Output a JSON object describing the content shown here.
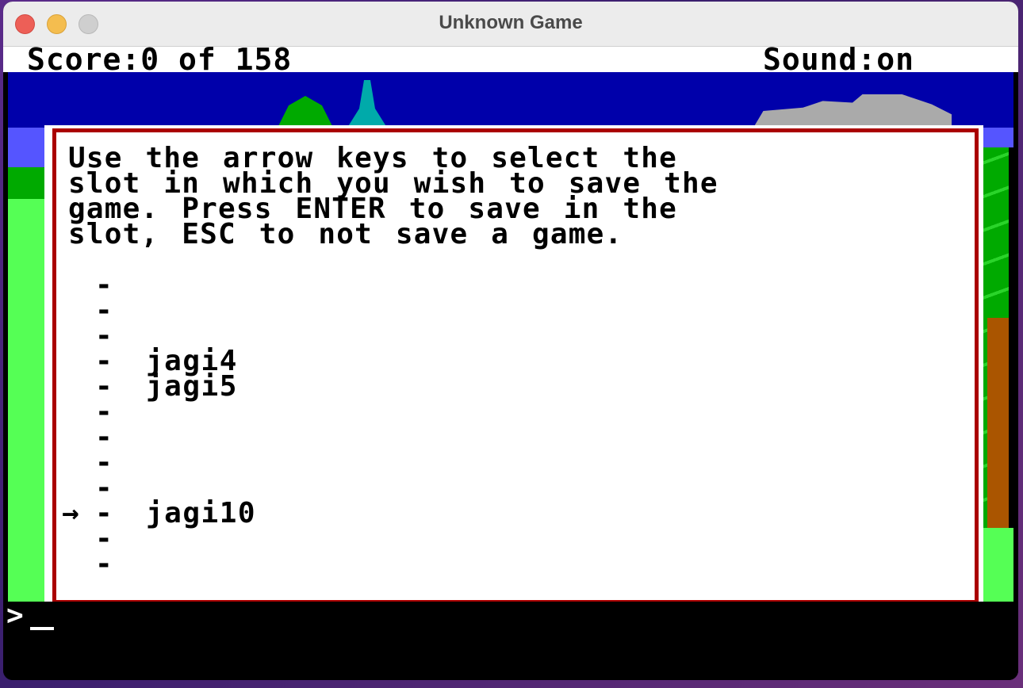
{
  "window": {
    "title": "Unknown Game"
  },
  "status": {
    "score": "Score:0 of 158",
    "sound": "Sound:on"
  },
  "dialog": {
    "prompt": "Use the arrow keys to select the\nslot in which you wish to save the\ngame. Press ENTER to save in the\nslot, ESC to not save a game."
  },
  "slots": [
    {
      "marker": "",
      "dash": "-",
      "name": ""
    },
    {
      "marker": "",
      "dash": "-",
      "name": ""
    },
    {
      "marker": "",
      "dash": "-",
      "name": ""
    },
    {
      "marker": "",
      "dash": "-",
      "name": "jagi4"
    },
    {
      "marker": "",
      "dash": "-",
      "name": "jagi5"
    },
    {
      "marker": "",
      "dash": "-",
      "name": ""
    },
    {
      "marker": "",
      "dash": "-",
      "name": ""
    },
    {
      "marker": "",
      "dash": "-",
      "name": ""
    },
    {
      "marker": "",
      "dash": "-",
      "name": ""
    },
    {
      "marker": "→",
      "dash": "-",
      "name": "jagi10"
    },
    {
      "marker": "",
      "dash": "-",
      "name": ""
    },
    {
      "marker": "",
      "dash": "-",
      "name": ""
    }
  ],
  "command_line": {
    "prompt": ">"
  },
  "colors": {
    "dialog_border": "#aa0000",
    "sky": "#0000aa",
    "grass": "#55ff55"
  }
}
